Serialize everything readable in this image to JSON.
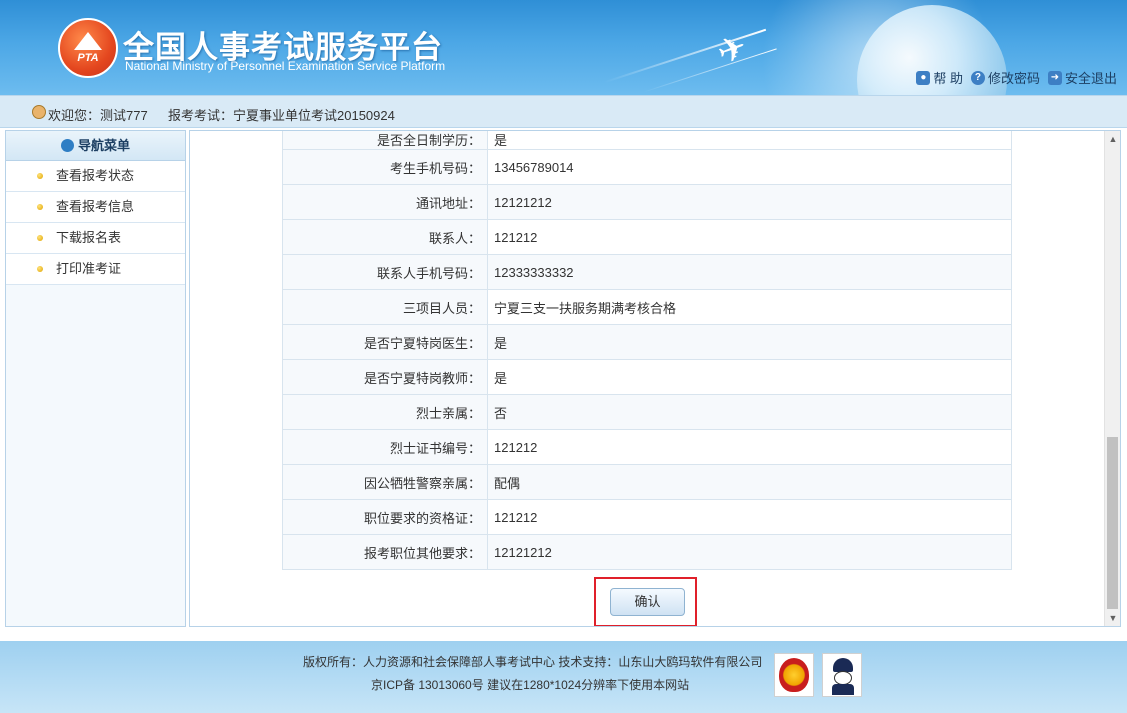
{
  "header": {
    "logo_text": "PTA",
    "title": "全国人事考试服务平台",
    "subtitle": "National Ministry of Personnel Examination Service Platform",
    "links": [
      {
        "label": "帮 助",
        "icon": "help-icon"
      },
      {
        "label": "修改密码",
        "icon": "lock-icon"
      },
      {
        "label": "安全退出",
        "icon": "exit-icon"
      }
    ]
  },
  "welcome": {
    "greeting": "欢迎您：测试777",
    "exam": "报考考试：宁夏事业单位考试20150924"
  },
  "sidebar": {
    "title": "导航菜单",
    "items": [
      {
        "label": "查看报考状态"
      },
      {
        "label": "查看报考信息"
      },
      {
        "label": "下载报名表"
      },
      {
        "label": "打印准考证"
      }
    ]
  },
  "form": {
    "rows": [
      {
        "label": "是否全日制学历：",
        "value": "是"
      },
      {
        "label": "考生手机号码：",
        "value": "13456789014"
      },
      {
        "label": "通讯地址：",
        "value": "12121212"
      },
      {
        "label": "联系人：",
        "value": "121212"
      },
      {
        "label": "联系人手机号码：",
        "value": "12333333332"
      },
      {
        "label": "三项目人员：",
        "value": "宁夏三支一扶服务期满考核合格"
      },
      {
        "label": "是否宁夏特岗医生：",
        "value": "是"
      },
      {
        "label": "是否宁夏特岗教师：",
        "value": "是"
      },
      {
        "label": "烈士亲属：",
        "value": "否"
      },
      {
        "label": "烈士证书编号：",
        "value": "121212"
      },
      {
        "label": "因公牺牲警察亲属：",
        "value": "配偶"
      },
      {
        "label": "职位要求的资格证：",
        "value": "121212"
      },
      {
        "label": "报考职位其他要求：",
        "value": "12121212"
      }
    ],
    "confirm_label": "确认"
  },
  "footer": {
    "line1": "版权所有：人力资源和社会保障部人事考试中心  技术支持：山东山大鸥玛软件有限公司",
    "line2": "京ICP备 13013060号  建议在1280*1024分辨率下使用本网站"
  },
  "colors": {
    "header_blue": "#2f8fd6",
    "highlight_red": "#e0202a",
    "accent_gold": "#e0a400"
  }
}
